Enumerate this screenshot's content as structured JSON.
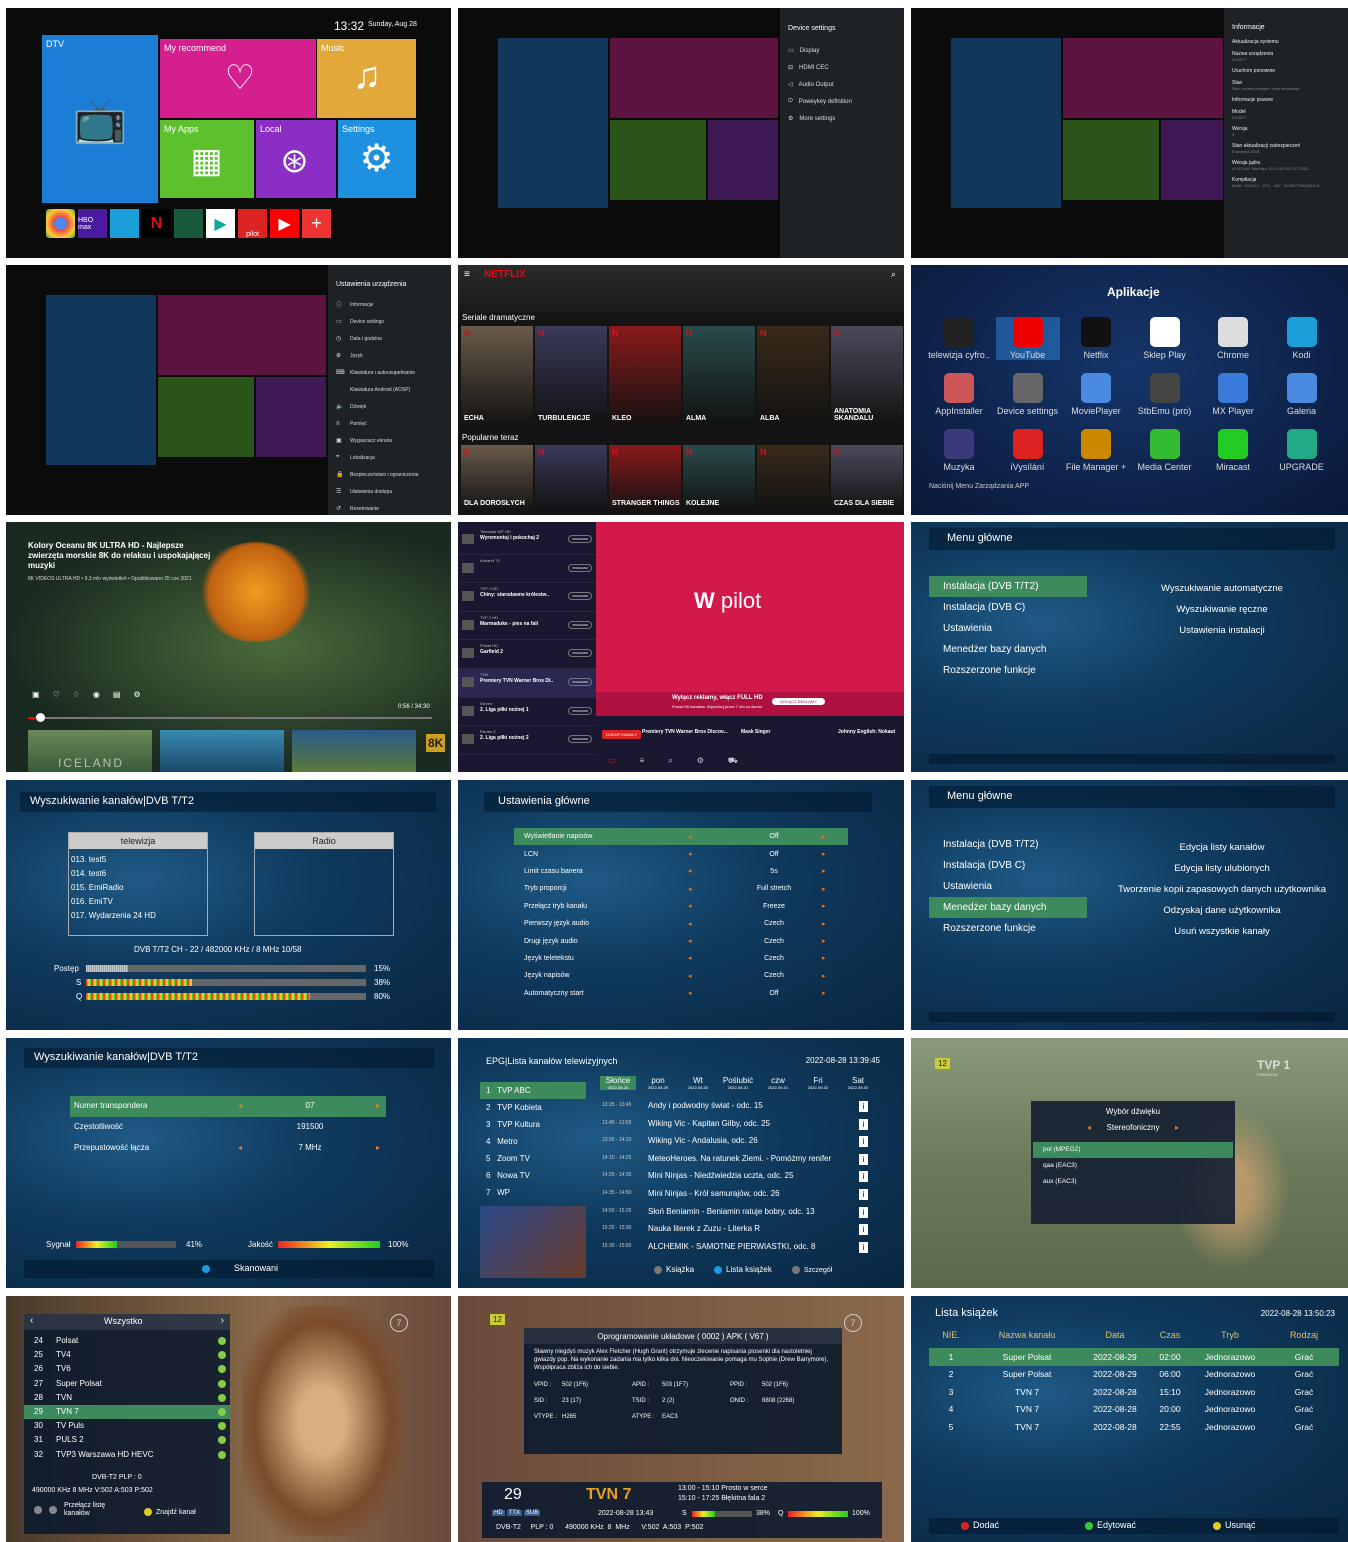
{
  "home": {
    "time": "13:32",
    "date": "Sunday, Aug 28",
    "tiles": [
      "DTV",
      "My recommend",
      "Music",
      "My Apps",
      "Local",
      "Settings"
    ],
    "dock": [
      "chrome-icon",
      "hbo-max-icon",
      "kodi-icon",
      "netflix-icon",
      "app-icon",
      "play-store-icon",
      "wp-pilot-icon",
      "youtube-icon",
      "add-icon"
    ],
    "wp": "pilot",
    "hbomax": "HBO max"
  },
  "device_settings": {
    "title": "Device settings",
    "items": [
      "Display",
      "HDMI CEC",
      "Audio Output",
      "Poweykey definition",
      "More settings"
    ]
  },
  "info": {
    "title": "Informacje",
    "items": [
      {
        "label": "Aktualizacja systemu",
        "sub": ""
      },
      {
        "label": "Nazwa urządzenia",
        "sub": "DV3077"
      },
      {
        "label": "Uruchom ponownie",
        "sub": ""
      },
      {
        "label": "Stan",
        "sub": "Sieć, numery seryjne i inne informacje"
      },
      {
        "label": "Informacje prawne",
        "sub": ""
      },
      {
        "label": "Model",
        "sub": "DV3077"
      },
      {
        "label": "Wersja",
        "sub": "9"
      },
      {
        "label": "Stan aktualizacji zabezpieczeń",
        "sub": "5 sierpnia 2018"
      },
      {
        "label": "Wersja jądra",
        "sub": "4.9.113 #1 Wed Apr 13 13:42:19 CST 2022"
      },
      {
        "label": "Kompilacja",
        "sub": "Build : V0002.1 . STV . V67 . DV3077V20220413"
      }
    ]
  },
  "ustawienia": {
    "title": "Ustawienia urządzenia",
    "items": [
      "Informacje",
      "Device settings",
      "Data i godzina",
      "Język",
      "Klawiatura i autouzupełnianie",
      "Klawiatura Android (AOSP)",
      "Dźwięk",
      "Pamięć",
      "Wygaszacz ekranu",
      "Lokalizacja",
      "Bezpieczeństwo i ograniczenia",
      "Ułatwienia dostępu",
      "Resetowanie"
    ]
  },
  "netflix": {
    "logo": "NETFLIX",
    "row1": "Seriale dramatyczne",
    "row2": "Popularne teraz",
    "posters1": [
      "ECHA",
      "TURBULENCJE",
      "KLEO",
      "ALMA",
      "ALBA",
      "ANATOMIA SKANDALU"
    ],
    "posters2": [
      "DLA DOROSŁYCH",
      "",
      "STRANGER THINGS",
      "KOLEJNE",
      "",
      "CZAS DLA SIEBIE"
    ]
  },
  "apps": {
    "title": "Aplikacje",
    "items": [
      "telewizja cyfro..",
      "YouTube",
      "Netflix",
      "Sklep Play",
      "Chrome",
      "Kodi",
      "AppInstaller",
      "Device settings",
      "MoviePlayer",
      "StbEmu (pro)",
      "MX Player",
      "Galeria",
      "Muzyka",
      "iVysílání",
      "File Manager +",
      "Media Center",
      "Miracast",
      "UPGRADE"
    ],
    "footer": "Naciśnij Menu Zarządzania APP"
  },
  "youtube": {
    "title": "Kolory Oceanu 8K ULTRA HD - Najlepsze zwierzęta morskie 8K do relaksu i uspokajającej muzyki",
    "meta": "8K VIDEOS ULTRA HD • 9,3 mln wyświetleń • Opublikowano 25 cze 2021",
    "time": "0:56 / 34:30",
    "thumb1": "ICELAND",
    "badge": "8K"
  },
  "wppilot": {
    "logo": "pilot",
    "ad": "Wyłącz reklamy, włącz FULL HD",
    "adsub": "Ponad 90 kanałów. Wypróbuj przez 7 dni za darmo",
    "adbtn": "WYŁĄCZ REKLAMY",
    "channels": [
      {
        "name": "Telewizja WP HD",
        "show": "Wyremontuj i pokochaj 2"
      },
      {
        "name": "Kabaret TV",
        "show": ""
      },
      {
        "name": "TVP 1 HD",
        "show": "Chiny: starodawne królestw.."
      },
      {
        "name": "TVP 2 HD",
        "show": "Marmaduke - pies na fali"
      },
      {
        "name": "Polsat HD",
        "show": "Garfield 2"
      },
      {
        "name": "TVN",
        "show": "Premiery TVN Warner Bros Di.."
      },
      {
        "name": "Eleven",
        "show": "2. Liga piłki nożnej 1"
      },
      {
        "name": "Eleven 2",
        "show": "2. Liga piłki nożnej 2"
      }
    ],
    "tag": "PROGRAM",
    "bottom": [
      "Premiery TVN Warner Bros Discov...",
      "Mask Singer",
      "Johnny English: Nokaut"
    ],
    "buy": "DOKUP KANAŁY"
  },
  "menu1": {
    "title": "Menu główne",
    "left": [
      "Instalacja (DVB T/T2)",
      "Instalacja (DVB C)",
      "Ustawienia",
      "Menedżer bazy danych",
      "Rozszerzone funkcje"
    ],
    "right": [
      "Wyszukiwanie automatyczne",
      "Wyszukiwanie ręczne",
      "Ustawienia instalacji"
    ]
  },
  "scan1": {
    "title": "Wyszukiwanie kanałów|DVB T/T2",
    "col1": "telewizja",
    "col2": "Radio",
    "list": [
      "013.   test5",
      "014.   test6",
      "015.   EmiRadio",
      "016.   EmiTV",
      "017.   Wydarzenia 24 HD"
    ],
    "info": "DVB T/T2   CH - 22 / 482000 KHz / 8 MHz  10/58",
    "bars": [
      {
        "label": "Postęp",
        "pct": "15%",
        "v": 0.15
      },
      {
        "label": "S",
        "pct": "38%",
        "v": 0.38
      },
      {
        "label": "Q",
        "pct": "80%",
        "v": 0.8
      }
    ]
  },
  "settings_main": {
    "title": "Ustawienia główne",
    "rows": [
      [
        "Wyświetlanie napisów",
        "Off"
      ],
      [
        "LCN",
        "Off"
      ],
      [
        "Limit czasu banera",
        "5s"
      ],
      [
        "Tryb proporcji",
        "Full stretch"
      ],
      [
        "Przełącz tryb kanału",
        "Freeze"
      ],
      [
        "Pierwszy język audio",
        "Czech"
      ],
      [
        "Drugi język audio",
        "Czech"
      ],
      [
        "Język teletekstu",
        "Czech"
      ],
      [
        "Język napisów",
        "Czech"
      ],
      [
        "Automatyczny start",
        "Off"
      ]
    ]
  },
  "menu2": {
    "title": "Menu główne",
    "left": [
      "Instalacja (DVB T/T2)",
      "Instalacja (DVB C)",
      "Ustawienia",
      "Menedżer bazy danych",
      "Rozszerzone funkcje"
    ],
    "right": [
      "Edycja listy kanałów",
      "Edycja listy ulubionych",
      "Tworzenie kopii zapasowych danych użytkownika",
      "Odzyskaj dane użytkownika",
      "Usuń wszystkie kanały"
    ]
  },
  "scan2": {
    "title": "Wyszukiwanie kanałów|DVB T/T2",
    "rows": [
      [
        "Numer transpondera",
        "07"
      ],
      [
        "Częstotliwość",
        "191500"
      ],
      [
        "Przepustowość łącza",
        "7 MHz"
      ]
    ],
    "sig": "Sygnał",
    "sigpct": "41%",
    "sigv": 0.41,
    "jak": "Jakość",
    "jakpct": "100%",
    "jakv": 1.0,
    "btn": "Skanowani"
  },
  "epg": {
    "title": "EPG|Lista kanałów telewizyjnych",
    "datetime": "2022-08-28 13:39:45",
    "channels": [
      "1   TVP ABC",
      "2   TVP Kobieta",
      "3   TVP Kultura",
      "4   Metro",
      "5   Zoom TV",
      "6   Nowa TV",
      "7   WP"
    ],
    "days": [
      [
        "Słońce",
        "2022-08-28"
      ],
      [
        "pon",
        "2022-08-29"
      ],
      [
        "Wt",
        "2022-08-30"
      ],
      [
        "Poślubić",
        "2022-08-31"
      ],
      [
        "czw",
        "2022-09-01"
      ],
      [
        "Fri",
        "2022-09-02"
      ],
      [
        "Sat",
        "2022-09-03"
      ]
    ],
    "progs": [
      [
        "13:25 - 13:45",
        "Andy i podwodny świat - odc. 15"
      ],
      [
        "13:45 - 13:55",
        "Wiking Vic - Kapitan Gilby, odc. 25"
      ],
      [
        "13:55 - 14:10",
        "Wiking Vic - Andalusia, odc. 26"
      ],
      [
        "14:10 - 14:25",
        "MeteoHeroes. Na ratunek Ziemi. - Pomóżmy renifer"
      ],
      [
        "14:25 - 14:35",
        "Mini Ninjas - Niedźwiedzia uczta, odc. 25"
      ],
      [
        "14:35 - 14:50",
        "Mini Ninjas - Król samurajów, odc. 26"
      ],
      [
        "14:50 - 15:25",
        "Słoń Beniamin - Beniamin ratuje bobry, odc. 13"
      ],
      [
        "15:25 - 15:30",
        "Nauka literek z Zuzu - Literka R"
      ],
      [
        "15:30 - 15:50",
        "ALCHEMIK - SAMOTNE PIERWIASTKI, odc. 8"
      ]
    ],
    "foot": [
      "Książka",
      "Lista książek",
      "Szczegół"
    ]
  },
  "audio": {
    "title": "Wybór dźwięku",
    "mode": "Stereofoniczny",
    "items": [
      "pol (MPEG2)",
      "qaa (EAC3)",
      "aux (EAC3)"
    ],
    "age": "12",
    "logo": "TVP 1",
    "sub": "PREMIERA"
  },
  "chlist": {
    "title": "Wszystko",
    "items": [
      [
        "24",
        "Polsat"
      ],
      [
        "25",
        "TV4"
      ],
      [
        "26",
        "TV6"
      ],
      [
        "27",
        "Super Polsat"
      ],
      [
        "28",
        "TVN"
      ],
      [
        "29",
        "TVN 7"
      ],
      [
        "30",
        "TV Puls"
      ],
      [
        "31",
        "PULS 2"
      ],
      [
        "32",
        "TVP3 Warszawa HD HEVC"
      ]
    ],
    "info1": "DVB-T2    PLP : 0",
    "info2": "490000 KHz  8  MHz      V:502  A:503  P:502",
    "b1": "Przełącz listę kanałów",
    "b2": "Znajdź kanał",
    "badge": "7"
  },
  "chinfo": {
    "title": "Oprogramowanie układowe ( 0002 )  APK ( V67 )",
    "desc": "Sławny niegdyś muzyk Alex Fletcher (Hugh Grant) otrzymuje zlecenie napisania piosenki dla nastoletniej gwiazdy pop. Na wykonanie zadania ma tylko kilka dni. Nieoczekiwanie pomaga mu Sophie (Drew Barrymore). Współpraca zbliża ich do siebie.",
    "fields": [
      [
        "VPID :",
        "502 (1F6)",
        "APID :",
        "503 (1F7)",
        "PPID :",
        "502 (1F6)"
      ],
      [
        "SID :",
        "23 (17)",
        "TSID :",
        "2 (2)",
        "ONID :",
        "8808 (2268)"
      ],
      [
        "VTYPE :",
        "H265",
        "ATYPE :",
        "EAC3",
        "",
        ""
      ]
    ],
    "num": "29",
    "name": "TVN 7",
    "prog1": "13:00 - 15:10  Prosto w serce",
    "prog2": "15:10 - 17:25  Błękitna fala 2",
    "tags": [
      "HD",
      "TTX",
      "SUB"
    ],
    "dt": "2022-08-28 13:43",
    "s": "S",
    "spct": "38%",
    "q": "Q",
    "qpct": "100%",
    "sv": 0.38,
    "qv": 1.0,
    "foot": "DVB-T2     PLP : 0      490000 KHz  8  MHz      V:502  A:503  P:502",
    "age": "12",
    "badge": "7"
  },
  "books": {
    "title": "Lista książek",
    "datetime": "2022-08-28 13:50:23",
    "headers": [
      "NIE.",
      "Nazwa kanału",
      "Data",
      "Czas",
      "Tryb",
      "Rodzaj"
    ],
    "rows": [
      [
        "1",
        "Super Polsat",
        "2022-08-29",
        "02:00",
        "Jednorazowo",
        "Grać"
      ],
      [
        "2",
        "Super Polsat",
        "2022-08-29",
        "06:00",
        "Jednorazowo",
        "Grać"
      ],
      [
        "3",
        "TVN 7",
        "2022-08-28",
        "15:10",
        "Jednorazowo",
        "Grać"
      ],
      [
        "4",
        "TVN 7",
        "2022-08-28",
        "20:00",
        "Jednorazowo",
        "Grać"
      ],
      [
        "5",
        "TVN 7",
        "2022-08-28",
        "22:55",
        "Jednorazowo",
        "Grać"
      ]
    ],
    "foot": [
      "Dodać",
      "Edytować",
      "Usunąć"
    ]
  }
}
